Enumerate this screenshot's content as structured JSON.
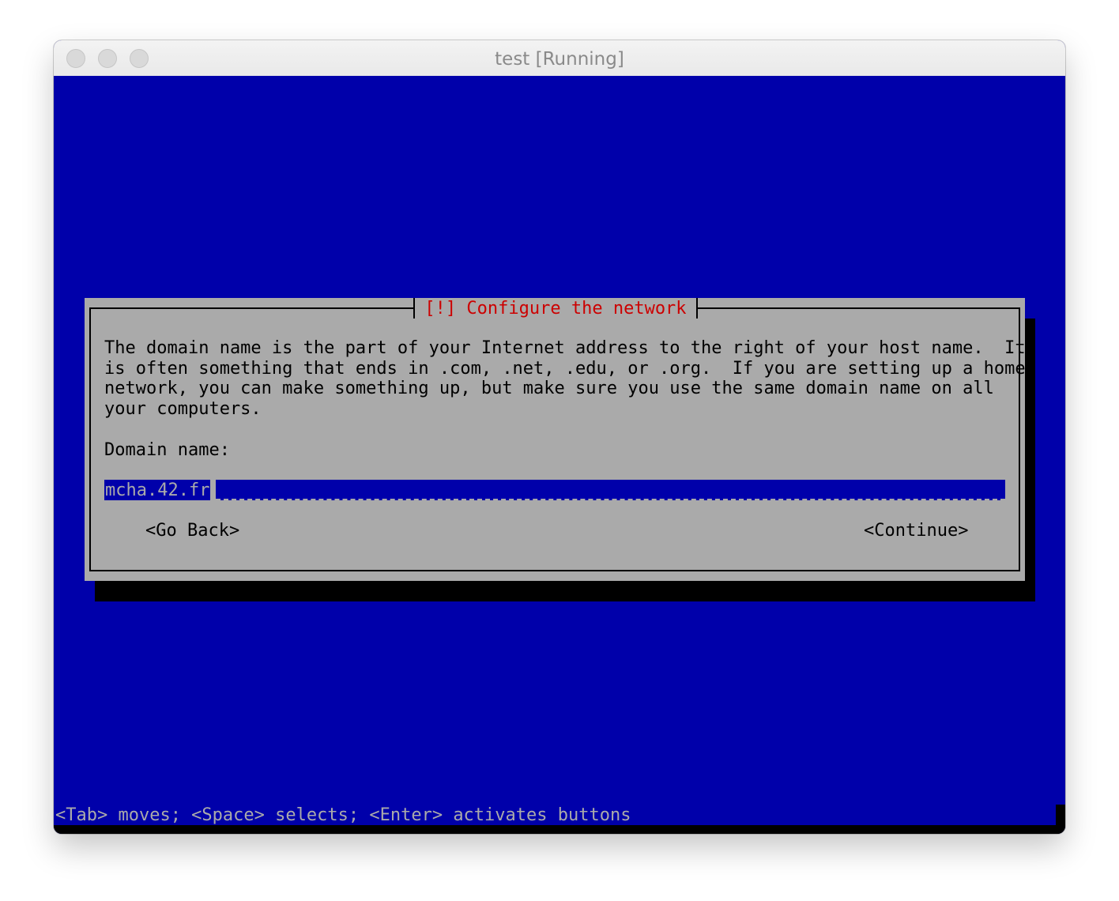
{
  "window": {
    "title": "test [Running]"
  },
  "dialog": {
    "title": "[!] Configure the network",
    "description": "The domain name is the part of your Internet address to the right of your host name.  It\nis often something that ends in .com, .net, .edu, or .org.  If you are setting up a home\nnetwork, you can make something up, but make sure you use the same domain name on all\nyour computers.",
    "field_label": "Domain name:",
    "field_value": "mcha.42.fr",
    "buttons": {
      "back": "<Go Back>",
      "continue": "<Continue>"
    }
  },
  "statusbar": {
    "help": "<Tab> moves; <Space> selects; <Enter> activates buttons"
  },
  "colors": {
    "screen_bg": "#0000aa",
    "dialog_bg": "#aaaaaa",
    "title_fg": "#cc0000",
    "text_fg": "#000000",
    "status_fg": "#aaaaaa"
  }
}
